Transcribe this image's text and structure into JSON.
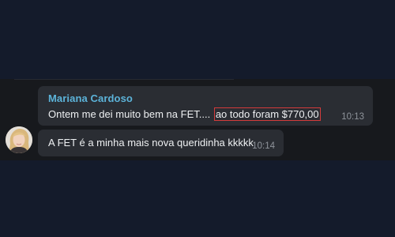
{
  "chat": {
    "messages": [
      {
        "sender": "Mariana Cardoso",
        "text_before": "Ontem me dei muito bem na FET.... ",
        "text_highlight": "ao todo foram $770,00",
        "time": "10:13"
      },
      {
        "text": "A FET é a minha mais nova queridinha kkkkk",
        "time": "10:14"
      }
    ]
  },
  "colors": {
    "sender_name": "#5cb3d9",
    "bubble": "#2a2d33",
    "highlight_border": "#d43b3b",
    "background": "#141b2b"
  },
  "icons": {
    "avatar": "user-photo-avatar"
  }
}
